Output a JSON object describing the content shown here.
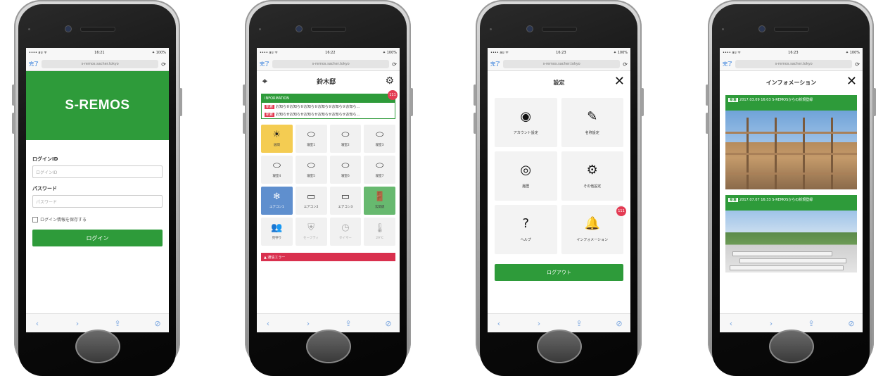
{
  "browser": {
    "carrier": "•••• au ᯤ",
    "battery": "✦ 100%",
    "done_label": "完了",
    "url": "s-remos.sacher.tokyo",
    "reload_icon": "⟳",
    "toolbar_icons": [
      "‹",
      "›",
      "⇪",
      "⊘"
    ]
  },
  "screen1": {
    "time": "16:21",
    "app_title": "S-REMOS",
    "login_id_label": "ログインID",
    "login_id_placeholder": "ログインID",
    "password_label": "パスワード",
    "password_placeholder": "パスワード",
    "remember_label": "ログイン情報を保存する",
    "login_button": "ログイン"
  },
  "screen2": {
    "time": "16:22",
    "title": "鈴木邸",
    "info_header": "INFORMATION",
    "info_badge": "111",
    "info_lines": [
      {
        "tag": "新着",
        "text": "お知らせお知らせお知らせお知らせお知らせお知ら…"
      },
      {
        "tag": "新着",
        "text": "お知らせお知らせお知らせお知らせお知らせお知ら…"
      }
    ],
    "tiles": [
      {
        "icon": "☀",
        "label": "居間",
        "style": "yellow"
      },
      {
        "icon": "⬭",
        "label": "寝室1",
        "style": ""
      },
      {
        "icon": "⬭",
        "label": "寝室2",
        "style": ""
      },
      {
        "icon": "⬭",
        "label": "寝室3",
        "style": ""
      },
      {
        "icon": "⬭",
        "label": "寝室4",
        "style": ""
      },
      {
        "icon": "⬭",
        "label": "寝室5",
        "style": ""
      },
      {
        "icon": "⬭",
        "label": "寝室6",
        "style": ""
      },
      {
        "icon": "⬭",
        "label": "寝室7",
        "style": ""
      },
      {
        "icon": "❄",
        "label": "エアコン1",
        "style": "blue"
      },
      {
        "icon": "▭",
        "label": "エアコン2",
        "style": ""
      },
      {
        "icon": "▭",
        "label": "エアコン3",
        "style": ""
      },
      {
        "icon": "🚪",
        "label": "玄関鍵",
        "style": "green"
      },
      {
        "icon": "👥",
        "label": "見守り",
        "style": ""
      },
      {
        "icon": "⛨",
        "label": "セーフティ",
        "style": "dim"
      },
      {
        "icon": "◷",
        "label": "タイマー",
        "style": "dim"
      },
      {
        "icon": "🌡",
        "label": "29℃",
        "style": "dim"
      }
    ],
    "error_label": "▲ 通信エラー"
  },
  "screen3": {
    "time": "16:23",
    "title": "設定",
    "close_icon": "✕",
    "tiles": [
      {
        "icon": "◉",
        "label": "アカウント設定"
      },
      {
        "icon": "✎",
        "label": "名称設定"
      },
      {
        "icon": "◎",
        "label": "履歴"
      },
      {
        "icon": "⚙",
        "label": "その他設定"
      },
      {
        "icon": "?",
        "label": "ヘルプ"
      },
      {
        "icon": "🔔",
        "label": "インフォメーション"
      }
    ],
    "info_badge": "111",
    "logout_button": "ログアウト"
  },
  "screen4": {
    "time": "16:23",
    "title": "インフォメーション",
    "close_icon": "✕",
    "cards": [
      {
        "tag": "新着",
        "text": "2017.03.09 16:03 S-REMOSからの新規登録"
      },
      {
        "tag": "新着",
        "text": "2017.07.07 16:33 S-REMOSからの新規登録"
      }
    ]
  }
}
